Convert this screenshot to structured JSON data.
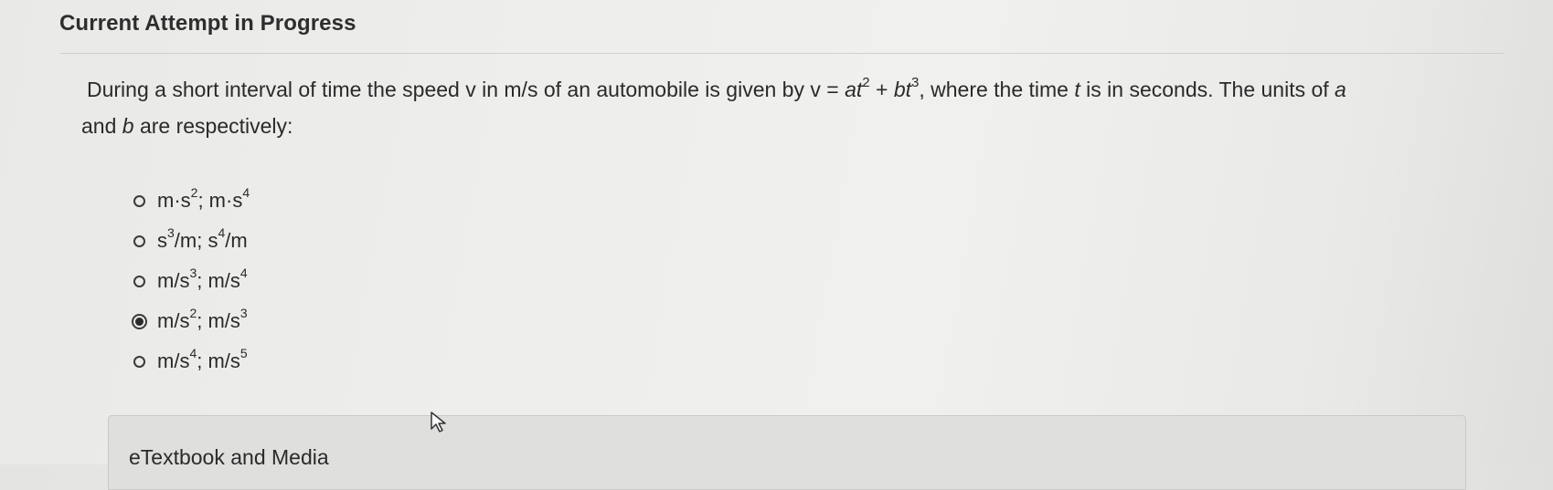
{
  "header": {
    "title": "Current Attempt in Progress"
  },
  "question": {
    "part1": "During a short interval of time the speed v in m/s of an automobile is given by v = ",
    "var_a": "a",
    "t1": "t",
    "exp1": "2",
    "plus": " + ",
    "var_b": "b",
    "t2": "t",
    "exp2": "3",
    "part2": ", where the time ",
    "var_t": "t",
    "part3": " is in seconds. The units of ",
    "var_a2": "a",
    "line_break_part": " and ",
    "var_b2": "b",
    "part4": " are respectively:"
  },
  "options": [
    {
      "a": "m·s",
      "ae": "2",
      "sep": "; m·s",
      "be": "4",
      "tail": "",
      "selected": false
    },
    {
      "a": "s",
      "ae": "3",
      "sep": "/m; s",
      "be": "4",
      "tail": "/m",
      "selected": false
    },
    {
      "a": "m/s",
      "ae": "3",
      "sep": "; m/s",
      "be": "4",
      "tail": "",
      "selected": false
    },
    {
      "a": "m/s",
      "ae": "2",
      "sep": "; m/s",
      "be": "3",
      "tail": "",
      "selected": true
    },
    {
      "a": "m/s",
      "ae": "4",
      "sep": "; m/s",
      "be": "5",
      "tail": "",
      "selected": false
    }
  ],
  "media": {
    "label": "eTextbook and Media"
  },
  "icons": {
    "cursor": "mouse-pointer-icon",
    "radio": "radio-button-icon"
  }
}
